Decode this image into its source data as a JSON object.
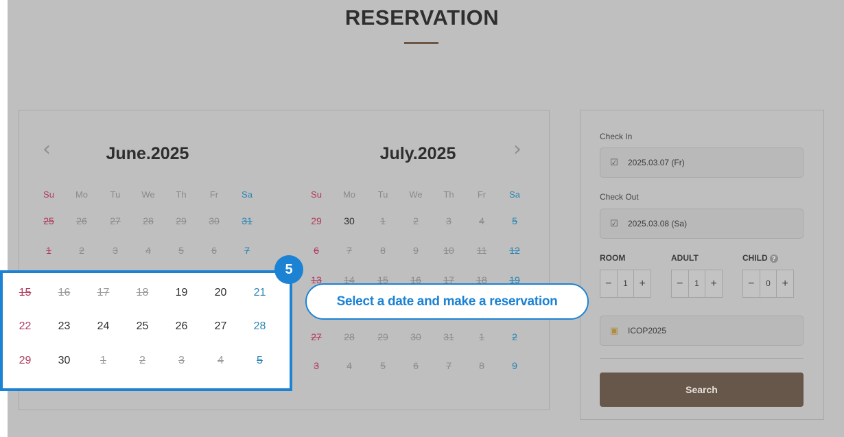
{
  "page": {
    "title": "RESERVATION"
  },
  "calendar": {
    "prev_icon": "chevron-left-icon",
    "next_icon": "chevron-right-icon",
    "weekdays": [
      "Su",
      "Mo",
      "Tu",
      "We",
      "Th",
      "Fr",
      "Sa"
    ],
    "months": [
      {
        "title": "June.2025",
        "rows": [
          [
            "25",
            "26",
            "27",
            "28",
            "29",
            "30",
            "31"
          ],
          [
            "1",
            "2",
            "3",
            "4",
            "5",
            "6",
            "7"
          ]
        ]
      },
      {
        "title": "July.2025",
        "rows": [
          [
            "29",
            "30",
            "1",
            "2",
            "3",
            "4",
            "5"
          ],
          [
            "6",
            "7",
            "8",
            "9",
            "10",
            "11",
            "12"
          ],
          [
            "13",
            "14",
            "15",
            "16",
            "17",
            "18",
            "19"
          ],
          [
            "",
            "",
            "",
            "",
            "",
            "",
            ""
          ],
          [
            "27",
            "28",
            "29",
            "30",
            "31",
            "1",
            "2"
          ],
          [
            "3",
            "4",
            "5",
            "6",
            "7",
            "8",
            "9"
          ]
        ]
      }
    ],
    "highlight_rows": [
      [
        "15",
        "16",
        "17",
        "18",
        "19",
        "20",
        "21"
      ],
      [
        "22",
        "23",
        "24",
        "25",
        "26",
        "27",
        "28"
      ],
      [
        "29",
        "30",
        "1",
        "2",
        "3",
        "4",
        "5"
      ]
    ]
  },
  "booking": {
    "check_in_label": "Check In",
    "check_in_value": "2025.03.07 (Fr)",
    "check_out_label": "Check Out",
    "check_out_value": "2025.03.08 (Sa)",
    "room_label": "ROOM",
    "room_value": "1",
    "adult_label": "ADULT",
    "adult_value": "1",
    "child_label": "CHILD",
    "child_value": "0",
    "help_glyph": "?",
    "promo_value": "ICOP2025",
    "search_label": "Search",
    "minus_glyph": "−",
    "plus_glyph": "+"
  },
  "annotation": {
    "step_number": "5",
    "callout_text": "Select a date and make a reservation",
    "accent_color": "#1c82d4"
  }
}
